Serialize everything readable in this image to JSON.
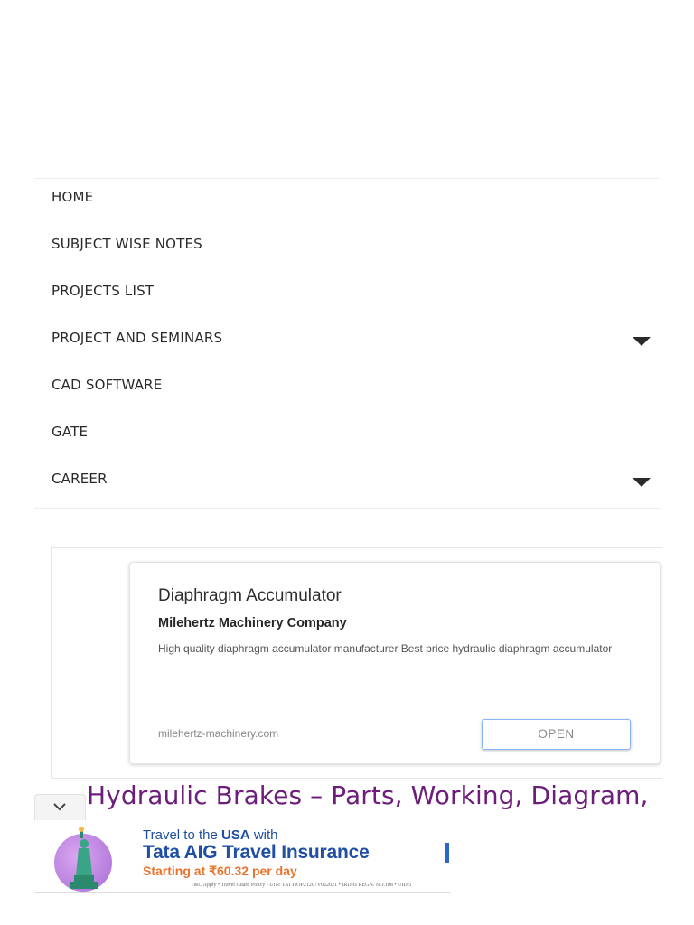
{
  "nav": {
    "items": [
      {
        "label": "HOME"
      },
      {
        "label": "SUBJECT WISE NOTES"
      },
      {
        "label": "PROJECTS LIST"
      },
      {
        "label": "PROJECT AND SEMINARS"
      },
      {
        "label": "CAD SOFTWARE"
      },
      {
        "label": "GATE"
      },
      {
        "label": "CAREER"
      }
    ]
  },
  "ad": {
    "title": "Diaphragm Accumulator",
    "company": "Milehertz Machinery Company",
    "description": "High quality diaphragm accumulator manufacturer Best price hydraulic diaphragm accumulator",
    "domain": "milehertz-machinery.com",
    "cta": "OPEN"
  },
  "article": {
    "title": "Hydraulic Brakes – Parts, Working, Diagram,"
  },
  "banner": {
    "line1_prefix": "Travel to the ",
    "line1_highlight": "USA",
    "line1_suffix": " with",
    "line2": "Tata AIG Travel Insurance",
    "line3": "Starting at ₹60.32 per day",
    "fine_print": "T&C Apply • Travel Guard Policy - UIN: TATTIOP21207V022021 • IRDAI REGN. NO.108 • UID 5"
  },
  "colors": {
    "article_title": "#6d1d7a",
    "banner_blue": "#1f4ea3",
    "banner_orange": "#e8732a",
    "cta_border": "#8ab4f8"
  }
}
